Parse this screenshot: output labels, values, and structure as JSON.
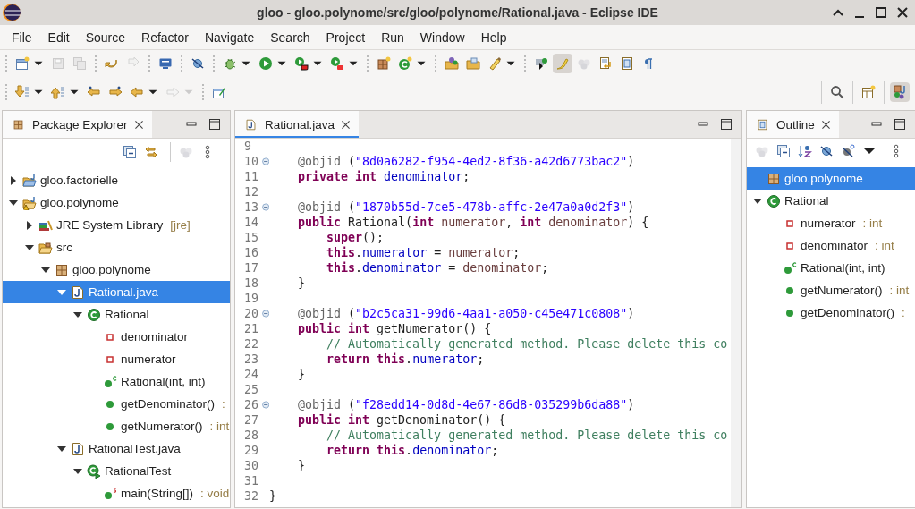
{
  "window": {
    "title": "gloo - gloo.polynome/src/gloo/polynome/Rational.java - Eclipse IDE"
  },
  "menu": [
    "File",
    "Edit",
    "Source",
    "Refactor",
    "Navigate",
    "Search",
    "Project",
    "Run",
    "Window",
    "Help"
  ],
  "toolbar": {
    "rows": [
      {
        "groups": [
          [
            {
              "kind": "new-window",
              "menu": true,
              "disabled": false,
              "on": false
            },
            {
              "kind": "floppy",
              "menu": false,
              "disabled": true,
              "on": false
            },
            {
              "kind": "floppies",
              "menu": false,
              "disabled": true,
              "on": false
            }
          ],
          [
            {
              "kind": "undo-arrow",
              "menu": false,
              "disabled": false,
              "on": false
            },
            {
              "kind": "redo-arrow",
              "menu": false,
              "disabled": true,
              "on": false
            }
          ],
          [
            {
              "kind": "monitor",
              "menu": false,
              "disabled": false,
              "on": false
            }
          ],
          [
            {
              "kind": "slashed-circle",
              "menu": false,
              "disabled": false,
              "on": false
            }
          ],
          [
            {
              "kind": "bug",
              "menu": true,
              "disabled": false,
              "on": false
            },
            {
              "kind": "play",
              "menu": true,
              "disabled": false,
              "on": false
            },
            {
              "kind": "play-square",
              "menu": true,
              "disabled": false,
              "on": false
            },
            {
              "kind": "play-toolbox",
              "menu": true,
              "disabled": false,
              "on": false
            }
          ],
          [
            {
              "kind": "grid-plus",
              "menu": false,
              "disabled": false,
              "on": false
            },
            {
              "kind": "class-plus",
              "menu": true,
              "disabled": false,
              "on": false
            }
          ],
          [
            {
              "kind": "folder-ball",
              "menu": false,
              "disabled": false,
              "on": false
            },
            {
              "kind": "folder",
              "menu": false,
              "disabled": false,
              "on": false
            },
            {
              "kind": "pen",
              "menu": true,
              "disabled": false,
              "on": false
            }
          ],
          [
            {
              "kind": "box-play",
              "menu": false,
              "disabled": false,
              "on": false
            },
            {
              "kind": "brush",
              "menu": false,
              "disabled": false,
              "on": true
            },
            {
              "kind": "bubbles",
              "menu": false,
              "disabled": true,
              "on": false
            },
            {
              "kind": "page-arrow",
              "menu": false,
              "disabled": false,
              "on": false
            },
            {
              "kind": "page-lines",
              "menu": false,
              "disabled": false,
              "on": false
            },
            {
              "kind": "pilcrow",
              "menu": false,
              "disabled": false,
              "on": false
            }
          ]
        ]
      },
      {
        "groups": [
          [
            {
              "kind": "arrow-down-page",
              "menu": true,
              "disabled": false,
              "on": false
            },
            {
              "kind": "arrow-up-page",
              "menu": true,
              "disabled": false,
              "on": false
            },
            {
              "kind": "arrow-left-star",
              "menu": false,
              "disabled": false,
              "on": false
            },
            {
              "kind": "arrow-right-star",
              "menu": false,
              "disabled": false,
              "on": false
            },
            {
              "kind": "arrow-left",
              "menu": true,
              "disabled": false,
              "on": false
            },
            {
              "kind": "arrow-right",
              "menu": true,
              "disabled": true,
              "on": false
            }
          ],
          [
            {
              "kind": "window-pen",
              "menu": false,
              "disabled": false,
              "on": false
            }
          ]
        ],
        "right": [
          [
            {
              "kind": "search",
              "menu": false,
              "disabled": false,
              "on": false
            }
          ],
          [
            {
              "kind": "grid-plus-window",
              "menu": false,
              "disabled": false,
              "on": false
            }
          ],
          [
            {
              "kind": "java-perspective",
              "menu": false,
              "disabled": false,
              "on": true
            }
          ]
        ]
      }
    ]
  },
  "package_explorer": {
    "tab": {
      "label": "Package Explorer",
      "selected": true
    },
    "toolbar": [
      [
        {
          "kind": "collapse-all",
          "menu": false,
          "disabled": false,
          "on": false
        },
        {
          "kind": "link-arrows",
          "menu": false,
          "disabled": false,
          "on": false
        }
      ],
      [
        {
          "kind": "bubbles",
          "menu": false,
          "disabled": true,
          "on": false
        },
        {
          "kind": "kebab",
          "menu": false,
          "disabled": false,
          "on": false
        }
      ]
    ],
    "tree": [
      {
        "label": "gloo.factorielle",
        "kind": "project-folder",
        "expanded": false,
        "selected": false
      },
      {
        "label": "gloo.polynome",
        "kind": "project-folder-warning",
        "expanded": true,
        "selected": false,
        "children": [
          {
            "label": "JRE System Library",
            "detail": "[jre]",
            "kind": "books",
            "expanded": false,
            "selected": false
          },
          {
            "label": "src",
            "kind": "folder-open",
            "expanded": true,
            "selected": false,
            "children": [
              {
                "label": "gloo.polynome",
                "kind": "package-grid",
                "expanded": true,
                "selected": false,
                "children": [
                  {
                    "label": "Rational.java",
                    "kind": "java-file",
                    "expanded": true,
                    "selected": true,
                    "children": [
                      {
                        "label": "Rational",
                        "kind": "class-circle",
                        "expanded": true,
                        "selected": false,
                        "children": [
                          {
                            "label": "denominator",
                            "kind": "field-square",
                            "selected": false
                          },
                          {
                            "label": "numerator",
                            "kind": "field-square",
                            "selected": false
                          },
                          {
                            "label": "Rational(int, int)",
                            "kind": "constructor-dot",
                            "selected": false
                          },
                          {
                            "label": "getDenominator()",
                            "detail": ":",
                            "kind": "method-dot",
                            "selected": false
                          },
                          {
                            "label": "getNumerator()",
                            "detail": ": int",
                            "kind": "method-dot",
                            "selected": false
                          }
                        ]
                      }
                    ]
                  },
                  {
                    "label": "RationalTest.java",
                    "kind": "java-file",
                    "expanded": true,
                    "selected": false,
                    "children": [
                      {
                        "label": "RationalTest",
                        "kind": "test-class-circle",
                        "expanded": true,
                        "selected": false,
                        "children": [
                          {
                            "label": "main(String[])",
                            "detail": ": void",
                            "kind": "static-method-dot",
                            "selected": false
                          }
                        ]
                      }
                    ]
                  }
                ]
              }
            ]
          }
        ]
      }
    ]
  },
  "editor": {
    "tab": {
      "label": "Rational.java",
      "selected": true
    },
    "lines": [
      {
        "number": "9",
        "fold": false
      },
      {
        "number": "10",
        "fold": true,
        "tokens": [
          {
            "kind": "annotation",
            "text": "    @objid"
          },
          {
            "kind": "plain",
            "text": " ("
          },
          {
            "kind": "string",
            "text": "\"8d0a6282-f954-4ed2-8f36-a42d6773bac2\""
          },
          {
            "kind": "plain",
            "text": ")"
          }
        ]
      },
      {
        "number": "11",
        "fold": false,
        "tokens": [
          {
            "kind": "keyword",
            "text": "    private int "
          },
          {
            "kind": "field",
            "text": "denominator"
          },
          {
            "kind": "plain",
            "text": ";"
          }
        ]
      },
      {
        "number": "12",
        "fold": false
      },
      {
        "number": "13",
        "fold": true,
        "tokens": [
          {
            "kind": "annotation",
            "text": "    @objid"
          },
          {
            "kind": "plain",
            "text": " ("
          },
          {
            "kind": "string",
            "text": "\"1870b55d-7ce5-478b-affc-2e47a0a0d2f3\""
          },
          {
            "kind": "plain",
            "text": ")"
          }
        ]
      },
      {
        "number": "14",
        "fold": false,
        "tokens": [
          {
            "kind": "keyword",
            "text": "    public"
          },
          {
            "kind": "plain",
            "text": " Rational("
          },
          {
            "kind": "keyword",
            "text": "int "
          },
          {
            "kind": "param",
            "text": "numerator"
          },
          {
            "kind": "plain",
            "text": ", "
          },
          {
            "kind": "keyword",
            "text": "int "
          },
          {
            "kind": "param",
            "text": "denominator"
          },
          {
            "kind": "plain",
            "text": ") {"
          }
        ]
      },
      {
        "number": "15",
        "fold": false,
        "tokens": [
          {
            "kind": "keyword",
            "text": "        super"
          },
          {
            "kind": "plain",
            "text": "();"
          }
        ]
      },
      {
        "number": "16",
        "fold": false,
        "tokens": [
          {
            "kind": "keyword",
            "text": "        this"
          },
          {
            "kind": "plain",
            "text": "."
          },
          {
            "kind": "field",
            "text": "numerator"
          },
          {
            "kind": "plain",
            "text": " = "
          },
          {
            "kind": "param",
            "text": "numerator"
          },
          {
            "kind": "plain",
            "text": ";"
          }
        ]
      },
      {
        "number": "17",
        "fold": false,
        "tokens": [
          {
            "kind": "keyword",
            "text": "        this"
          },
          {
            "kind": "plain",
            "text": "."
          },
          {
            "kind": "field",
            "text": "denominator"
          },
          {
            "kind": "plain",
            "text": " = "
          },
          {
            "kind": "param",
            "text": "denominator"
          },
          {
            "kind": "plain",
            "text": ";"
          }
        ]
      },
      {
        "number": "18",
        "fold": false,
        "tokens": [
          {
            "kind": "plain",
            "text": "    }"
          }
        ]
      },
      {
        "number": "19",
        "fold": false
      },
      {
        "number": "20",
        "fold": true,
        "tokens": [
          {
            "kind": "annotation",
            "text": "    @objid"
          },
          {
            "kind": "plain",
            "text": " ("
          },
          {
            "kind": "string",
            "text": "\"b2c5ca31-99d6-4aa1-a050-c45e471c0808\""
          },
          {
            "kind": "plain",
            "text": ")"
          }
        ]
      },
      {
        "number": "21",
        "fold": false,
        "tokens": [
          {
            "kind": "keyword",
            "text": "    public int"
          },
          {
            "kind": "plain",
            "text": " getNumerator() {"
          }
        ]
      },
      {
        "number": "22",
        "fold": false,
        "tokens": [
          {
            "kind": "comment",
            "text": "        // Automatically generated method. Please delete this co"
          }
        ]
      },
      {
        "number": "23",
        "fold": false,
        "tokens": [
          {
            "kind": "keyword",
            "text": "        return this"
          },
          {
            "kind": "plain",
            "text": "."
          },
          {
            "kind": "field",
            "text": "numerator"
          },
          {
            "kind": "plain",
            "text": ";"
          }
        ]
      },
      {
        "number": "24",
        "fold": false,
        "tokens": [
          {
            "kind": "plain",
            "text": "    }"
          }
        ]
      },
      {
        "number": "25",
        "fold": false
      },
      {
        "number": "26",
        "fold": true,
        "tokens": [
          {
            "kind": "annotation",
            "text": "    @objid"
          },
          {
            "kind": "plain",
            "text": " ("
          },
          {
            "kind": "string",
            "text": "\"f28edd14-0d8d-4e67-86d8-035299b6da88\""
          },
          {
            "kind": "plain",
            "text": ")"
          }
        ]
      },
      {
        "number": "27",
        "fold": false,
        "tokens": [
          {
            "kind": "keyword",
            "text": "    public int"
          },
          {
            "kind": "plain",
            "text": " getDenominator() {"
          }
        ]
      },
      {
        "number": "28",
        "fold": false,
        "tokens": [
          {
            "kind": "comment",
            "text": "        // Automatically generated method. Please delete this co"
          }
        ]
      },
      {
        "number": "29",
        "fold": false,
        "tokens": [
          {
            "kind": "keyword",
            "text": "        return this"
          },
          {
            "kind": "plain",
            "text": "."
          },
          {
            "kind": "field",
            "text": "denominator"
          },
          {
            "kind": "plain",
            "text": ";"
          }
        ]
      },
      {
        "number": "30",
        "fold": false,
        "tokens": [
          {
            "kind": "plain",
            "text": "    }"
          }
        ]
      },
      {
        "number": "31",
        "fold": false
      },
      {
        "number": "32",
        "fold": false,
        "tokens": [
          {
            "kind": "plain",
            "text": "}"
          }
        ]
      }
    ]
  },
  "outline": {
    "tab": {
      "label": "Outline",
      "selected": true
    },
    "toolbar": [
      [
        {
          "kind": "bubbles",
          "menu": false,
          "disabled": true,
          "on": false
        },
        {
          "kind": "collapse-all",
          "menu": false,
          "disabled": false,
          "on": false
        },
        {
          "kind": "sort-az",
          "menu": false,
          "disabled": false,
          "on": false
        },
        {
          "kind": "slashed-ball",
          "menu": false,
          "disabled": false,
          "on": false
        },
        {
          "kind": "slashed-static-ball",
          "menu": false,
          "disabled": false,
          "on": false
        },
        {
          "kind": "menu-caret",
          "menu": false,
          "disabled": false,
          "on": false
        }
      ],
      [
        {
          "kind": "kebab",
          "menu": false,
          "disabled": false,
          "on": false
        }
      ]
    ],
    "tree": [
      {
        "label": "gloo.polynome",
        "kind": "package-grid",
        "selected": true
      },
      {
        "label": "Rational",
        "kind": "class-circle",
        "expanded": true,
        "selected": false,
        "children": [
          {
            "label": "numerator",
            "detail": ": int",
            "kind": "field-square",
            "selected": false
          },
          {
            "label": "denominator",
            "detail": ": int",
            "kind": "field-square",
            "selected": false
          },
          {
            "label": "Rational(int, int)",
            "kind": "constructor-dot",
            "selected": false
          },
          {
            "label": "getNumerator()",
            "detail": ": int",
            "kind": "method-dot",
            "selected": false
          },
          {
            "label": "getDenominator()",
            "detail": ":",
            "kind": "method-dot",
            "selected": false
          }
        ]
      }
    ]
  }
}
